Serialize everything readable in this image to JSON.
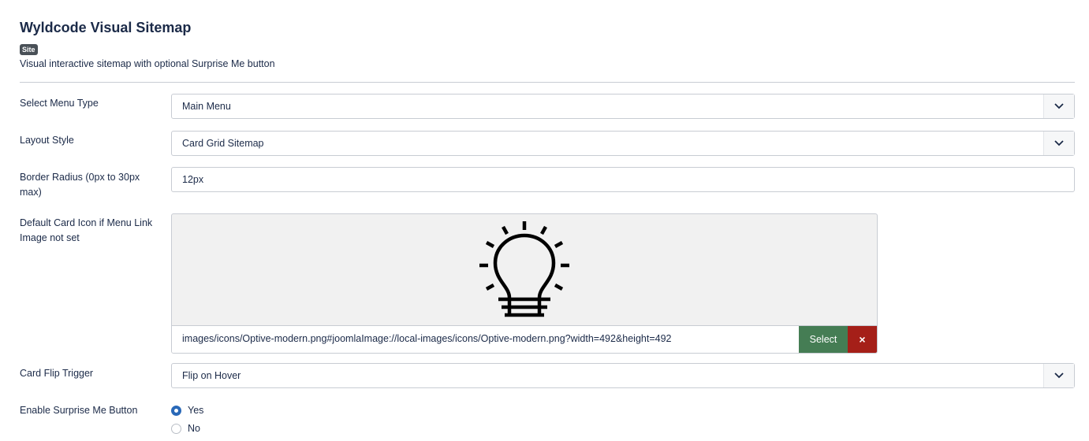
{
  "header": {
    "title": "Wyldcode Visual Sitemap",
    "badge": "Site",
    "description": "Visual interactive sitemap with optional Surprise Me button"
  },
  "fields": {
    "menu_type": {
      "label": "Select Menu Type",
      "value": "Main Menu"
    },
    "layout_style": {
      "label": "Layout Style",
      "value": "Card Grid Sitemap"
    },
    "border_radius": {
      "label": "Border Radius (0px to 30px max)",
      "value": "12px"
    },
    "default_icon": {
      "label": "Default Card Icon if Menu Link Image not set",
      "path": "images/icons/Optive-modern.png#joomlaImage://local-images/icons/Optive-modern.png?width=492&height=492",
      "select_label": "Select",
      "clear_label": "×",
      "preview_icon": "lightbulb-icon"
    },
    "flip_trigger": {
      "label": "Card Flip Trigger",
      "value": "Flip on Hover"
    },
    "surprise_me": {
      "label": "Enable Surprise Me Button",
      "options": [
        "Yes",
        "No"
      ],
      "selected": "Yes"
    }
  },
  "colors": {
    "select_button": "#457d54",
    "clear_button": "#a51f18",
    "radio_selected": "#2a69b8",
    "text": "#1b2a48"
  }
}
